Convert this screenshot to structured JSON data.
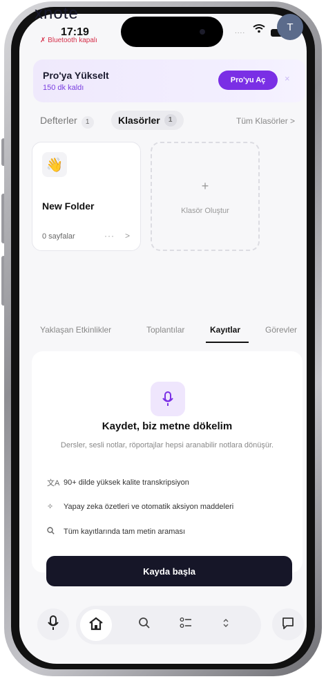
{
  "app": {
    "logo": "xnote"
  },
  "status_bar": {
    "time": "17:19",
    "bluetooth": "Bluetooth kapalı",
    "signal": "....",
    "avatar_initial": "T"
  },
  "pro_banner": {
    "title": "Pro'ya Yükselt",
    "subtitle": "150 dk kaldı",
    "button": "Pro'yu Aç",
    "close": "×"
  },
  "top_tabs": {
    "notebooks": {
      "label": "Defterler",
      "count": "1"
    },
    "folders": {
      "label": "Klasörler",
      "count": "1"
    },
    "all_link": "Tüm Klasörler >"
  },
  "folders": [
    {
      "emoji": "👋",
      "name": "New Folder",
      "pages": "0 sayfalar",
      "more": "···",
      "chevron": ">"
    }
  ],
  "create_folder": {
    "plus": "+",
    "label": "Klasör Oluştur"
  },
  "bottom_tabs": [
    {
      "label": "Yaklaşan Etkinlikler",
      "active": false
    },
    {
      "label": "Toplantılar",
      "active": false
    },
    {
      "label": "Kayıtlar",
      "active": true
    },
    {
      "label": "Görevler",
      "active": false
    }
  ],
  "recordings": {
    "title": "Kaydet, biz metne dökelim",
    "description": "Dersler, sesli notlar, röportajlar hepsi aranabilir notlara dönüşür.",
    "features": [
      {
        "icon": "translate-icon",
        "glyph": "文A",
        "text": "90+ dilde yüksek kalite transkripsiyon"
      },
      {
        "icon": "sparkles-icon",
        "glyph": "✧",
        "text": "Yapay zeka özetleri ve otomatik aksiyon maddeleri"
      },
      {
        "icon": "search-icon",
        "glyph": "⚲",
        "text": "Tüm kayıtlarında tam metin araması"
      }
    ],
    "start_button": "Kayda başla"
  },
  "nav": {
    "icons": [
      "mic-icon",
      "home-icon",
      "search-icon",
      "tasks-icon",
      "expand-icon",
      "chat-icon"
    ]
  },
  "colors": {
    "accent": "#7a2fe5",
    "dark": "#161628",
    "bluetooth_red": "#d6304a"
  }
}
